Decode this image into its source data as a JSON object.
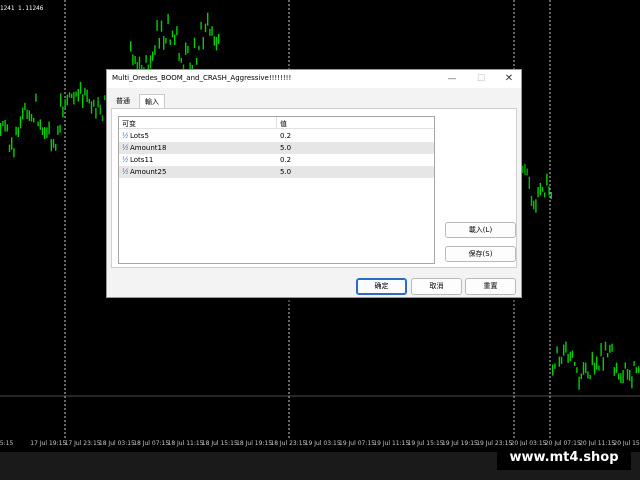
{
  "chart": {
    "price_readout": "1241 1.11246",
    "time_labels": [
      "15:15",
      "17 Jul 19:15",
      "17 Jul 23:15",
      "18 Jul 03:15",
      "18 Jul 07:15",
      "18 Jul 11:15",
      "18 Jul 15:15",
      "18 Jul 19:15",
      "18 Jul 23:15",
      "19 Jul 03:15",
      "19 Jul 07:15",
      "19 Jul 11:15",
      "19 Jul 15:15",
      "19 Jul 19:15",
      "19 Jul 23:15",
      "20 Jul 03:15",
      "20 Jul 07:15",
      "20 Jul 11:15",
      "20 Jul 15:15",
      "2"
    ],
    "candle_color": "#00d000",
    "grid_color": "#ffffff"
  },
  "dialog": {
    "title": "Multi_Oredes_BOOM_and_CRASH_Aggressive!!!!!!!!",
    "minimize": "—",
    "maximize": "☐",
    "close": "✕",
    "tabs": [
      "普通",
      "輸入"
    ],
    "active_tab": "輸入",
    "table": {
      "headers": [
        "可变",
        "值"
      ],
      "rows": [
        {
          "icon": "½",
          "name": "Lots5",
          "value": "0.2"
        },
        {
          "icon": "½",
          "name": "Amount18",
          "value": "5.0"
        },
        {
          "icon": "½",
          "name": "Lots11",
          "value": "0.2"
        },
        {
          "icon": "½",
          "name": "Amount25",
          "value": "5.0"
        }
      ]
    },
    "load_button": "載入(L)",
    "save_button": "保存(S)",
    "ok_button": "确定",
    "cancel_button": "取消",
    "reset_button": "重置"
  },
  "watermark": "www.mt4.shop"
}
